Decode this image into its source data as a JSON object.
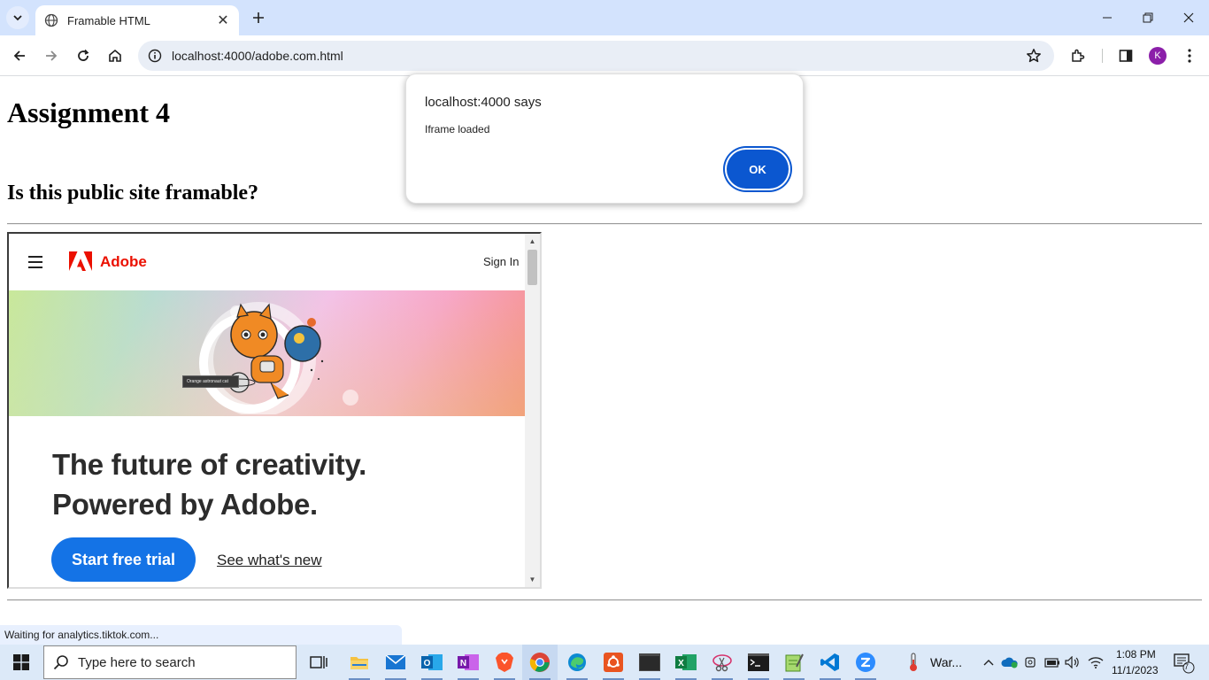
{
  "browser": {
    "tab_title": "Framable HTML",
    "url": "localhost:4000/adobe.com.html",
    "profile_initial": "K",
    "status_text": "Waiting for analytics.tiktok.com..."
  },
  "page": {
    "heading": "Assignment 4",
    "subheading": "Is this public site framable?"
  },
  "iframe": {
    "brand": "Adobe",
    "sign_in": "Sign In",
    "tooltip": "Orange astronaut cat",
    "headline_line1": "The future of creativity.",
    "headline_line2": "Powered by Adobe.",
    "cta": "Start free trial",
    "secondary_link": "See what's new"
  },
  "dialog": {
    "title": "localhost:4000 says",
    "message": "Iframe loaded",
    "ok": "OK"
  },
  "taskbar": {
    "search_placeholder": "Type here to search",
    "weather": "War...",
    "time": "1:08 PM",
    "date": "11/1/2023",
    "notification_count": "7"
  },
  "colors": {
    "adobe_red": "#eb1000",
    "adobe_blue": "#1473e6",
    "dialog_button": "#0b57d0",
    "tabstrip": "#d3e3fd"
  }
}
